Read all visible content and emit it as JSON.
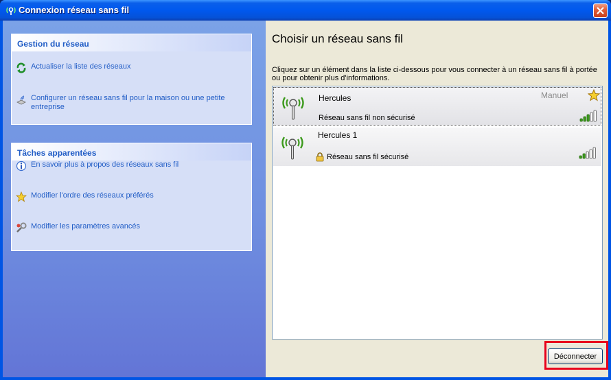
{
  "window": {
    "title": "Connexion réseau sans fil"
  },
  "sidebar": {
    "network_tasks": {
      "header": "Gestion du réseau",
      "items": [
        {
          "label": "Actualiser la liste des réseaux",
          "icon": "refresh-icon"
        },
        {
          "label": "Configurer un réseau sans fil pour la maison ou une petite entreprise",
          "icon": "setup-wizard-icon"
        }
      ]
    },
    "related_tasks": {
      "header": "Tâches apparentées",
      "items": [
        {
          "label": "En savoir plus à propos des réseaux sans fil",
          "icon": "info-icon"
        },
        {
          "label": "Modifier l'ordre des réseaux préférés",
          "icon": "star-icon"
        },
        {
          "label": "Modifier les paramètres avancés",
          "icon": "settings-icon"
        }
      ]
    }
  },
  "main": {
    "heading": "Choisir un réseau sans fil",
    "description": "Cliquez sur un élément dans la liste ci-dessous pour vous connecter à un réseau sans fil à portée ou pour obtenir plus d'informations.",
    "networks": [
      {
        "name": "Hercules",
        "status": "Réseau sans fil non sécurisé",
        "mode": "Manuel",
        "secured": false,
        "selected": true,
        "signal_bars": 3,
        "signal_max": 5
      },
      {
        "name": "Hercules 1",
        "status": "Réseau sans fil sécurisé",
        "mode": "",
        "secured": true,
        "selected": false,
        "signal_bars": 2,
        "signal_max": 5
      }
    ],
    "disconnect_label": "Déconnecter"
  },
  "colors": {
    "titlebar": "#0058ee",
    "sidebar_bg": "#6f8fe0",
    "task_link": "#215dc6",
    "signal_on": "#3c9a1c",
    "highlight": "#e8001c"
  }
}
